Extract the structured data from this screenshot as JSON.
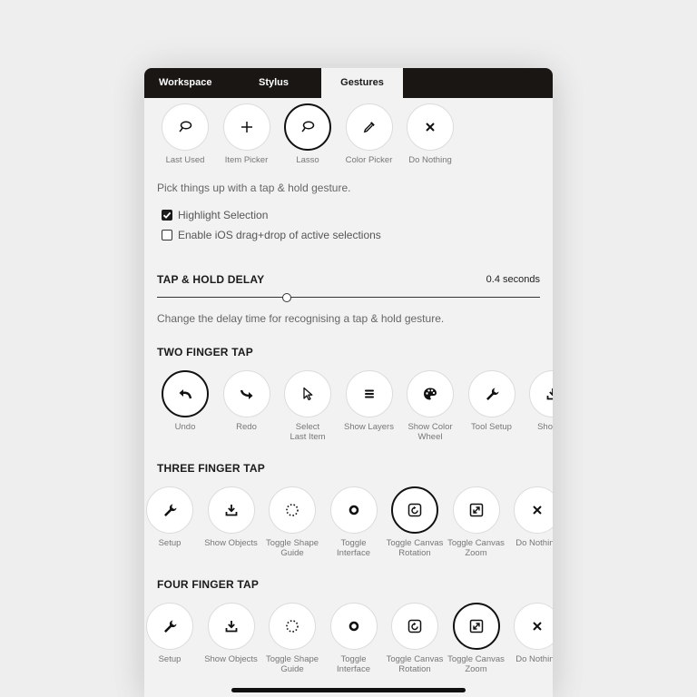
{
  "tabs": [
    {
      "label": "Workspace"
    },
    {
      "label": "Stylus"
    },
    {
      "label": "Gestures"
    }
  ],
  "tap_hold_options": [
    {
      "label": "Last Used",
      "icon": "lasso-icon"
    },
    {
      "label": "Item Picker",
      "icon": "plus-icon"
    },
    {
      "label": "Lasso",
      "icon": "lasso-icon",
      "selected": true
    },
    {
      "label": "Color Picker",
      "icon": "eyedropper-icon"
    },
    {
      "label": "Do Nothing",
      "icon": "close-icon"
    }
  ],
  "tap_hold_description": "Pick things up with a tap & hold gesture.",
  "checkboxes": {
    "highlight": {
      "label": "Highlight Selection",
      "checked": true
    },
    "drag_drop": {
      "label": "Enable iOS drag+drop of active selections",
      "checked": false
    }
  },
  "delay": {
    "title": "TAP & HOLD DELAY",
    "value": "0.4 seconds",
    "fraction": 0.34,
    "description": "Change the delay time for recognising a tap & hold gesture."
  },
  "two_finger": {
    "title": "TWO FINGER TAP",
    "options": [
      {
        "label": "Undo",
        "icon": "undo-icon",
        "selected": true
      },
      {
        "label": "Redo",
        "icon": "redo-icon"
      },
      {
        "label": "Select\nLast Item",
        "icon": "cursor-icon"
      },
      {
        "label": "Show Layers",
        "icon": "layers-icon"
      },
      {
        "label": "Show Color\nWheel",
        "icon": "palette-icon"
      },
      {
        "label": "Tool Setup",
        "icon": "wrench-icon"
      },
      {
        "label": "Show O",
        "icon": "download-icon"
      }
    ]
  },
  "three_finger": {
    "title": "THREE FINGER TAP",
    "options": [
      {
        "label": "Setup",
        "icon": "wrench-icon"
      },
      {
        "label": "Show Objects",
        "icon": "download-icon"
      },
      {
        "label": "Toggle Shape\nGuide",
        "icon": "dotted-circle-icon"
      },
      {
        "label": "Toggle\nInterface",
        "icon": "dot-circle-icon"
      },
      {
        "label": "Toggle Canvas\nRotation",
        "icon": "rotate-icon",
        "selected": true
      },
      {
        "label": "Toggle Canvas\nZoom",
        "icon": "zoom-icon"
      },
      {
        "label": "Do Nothing",
        "icon": "close-icon"
      }
    ]
  },
  "four_finger": {
    "title": "FOUR FINGER TAP",
    "options": [
      {
        "label": "Setup",
        "icon": "wrench-icon"
      },
      {
        "label": "Show Objects",
        "icon": "download-icon"
      },
      {
        "label": "Toggle Shape\nGuide",
        "icon": "dotted-circle-icon"
      },
      {
        "label": "Toggle\nInterface",
        "icon": "dot-circle-icon"
      },
      {
        "label": "Toggle Canvas\nRotation",
        "icon": "rotate-icon"
      },
      {
        "label": "Toggle Canvas\nZoom",
        "icon": "zoom-icon",
        "selected": true
      },
      {
        "label": "Do Nothing",
        "icon": "close-icon"
      }
    ]
  }
}
